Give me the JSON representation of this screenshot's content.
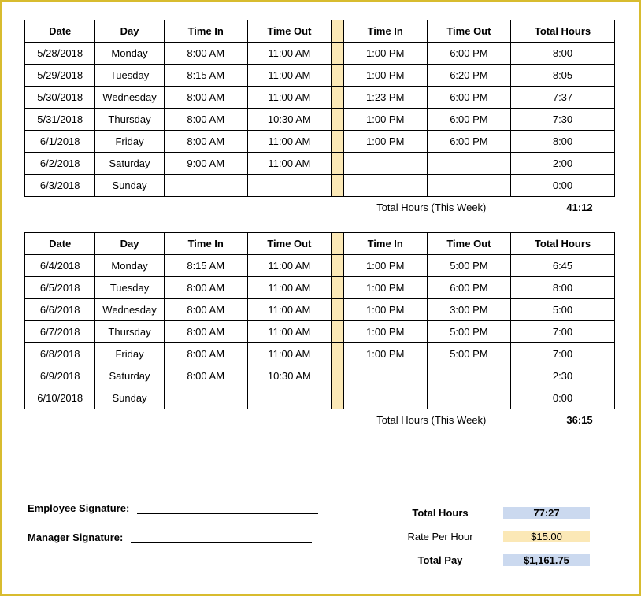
{
  "headers": {
    "date": "Date",
    "day": "Day",
    "time_in": "Time In",
    "time_out": "Time Out",
    "total_hours": "Total Hours"
  },
  "week_total_label": "Total Hours (This Week)",
  "week1": {
    "rows": [
      {
        "date": "5/28/2018",
        "day": "Monday",
        "in1": "8:00 AM",
        "out1": "11:00 AM",
        "in2": "1:00 PM",
        "out2": "6:00 PM",
        "total": "8:00"
      },
      {
        "date": "5/29/2018",
        "day": "Tuesday",
        "in1": "8:15 AM",
        "out1": "11:00 AM",
        "in2": "1:00 PM",
        "out2": "6:20 PM",
        "total": "8:05"
      },
      {
        "date": "5/30/2018",
        "day": "Wednesday",
        "in1": "8:00 AM",
        "out1": "11:00 AM",
        "in2": "1:23 PM",
        "out2": "6:00 PM",
        "total": "7:37"
      },
      {
        "date": "5/31/2018",
        "day": "Thursday",
        "in1": "8:00 AM",
        "out1": "10:30 AM",
        "in2": "1:00 PM",
        "out2": "6:00 PM",
        "total": "7:30"
      },
      {
        "date": "6/1/2018",
        "day": "Friday",
        "in1": "8:00 AM",
        "out1": "11:00 AM",
        "in2": "1:00 PM",
        "out2": "6:00 PM",
        "total": "8:00"
      },
      {
        "date": "6/2/2018",
        "day": "Saturday",
        "in1": "9:00 AM",
        "out1": "11:00 AM",
        "in2": "",
        "out2": "",
        "total": "2:00"
      },
      {
        "date": "6/3/2018",
        "day": "Sunday",
        "in1": "",
        "out1": "",
        "in2": "",
        "out2": "",
        "total": "0:00"
      }
    ],
    "total": "41:12"
  },
  "week2": {
    "rows": [
      {
        "date": "6/4/2018",
        "day": "Monday",
        "in1": "8:15 AM",
        "out1": "11:00 AM",
        "in2": "1:00 PM",
        "out2": "5:00 PM",
        "total": "6:45"
      },
      {
        "date": "6/5/2018",
        "day": "Tuesday",
        "in1": "8:00 AM",
        "out1": "11:00 AM",
        "in2": "1:00 PM",
        "out2": "6:00 PM",
        "total": "8:00"
      },
      {
        "date": "6/6/2018",
        "day": "Wednesday",
        "in1": "8:00 AM",
        "out1": "11:00 AM",
        "in2": "1:00 PM",
        "out2": "3:00 PM",
        "total": "5:00"
      },
      {
        "date": "6/7/2018",
        "day": "Thursday",
        "in1": "8:00 AM",
        "out1": "11:00 AM",
        "in2": "1:00 PM",
        "out2": "5:00 PM",
        "total": "7:00"
      },
      {
        "date": "6/8/2018",
        "day": "Friday",
        "in1": "8:00 AM",
        "out1": "11:00 AM",
        "in2": "1:00 PM",
        "out2": "5:00 PM",
        "total": "7:00"
      },
      {
        "date": "6/9/2018",
        "day": "Saturday",
        "in1": "8:00 AM",
        "out1": "10:30 AM",
        "in2": "",
        "out2": "",
        "total": "2:30"
      },
      {
        "date": "6/10/2018",
        "day": "Sunday",
        "in1": "",
        "out1": "",
        "in2": "",
        "out2": "",
        "total": "0:00"
      }
    ],
    "total": "36:15"
  },
  "summary": {
    "total_hours_label": "Total Hours",
    "total_hours_value": "77:27",
    "rate_label": "Rate Per Hour",
    "rate_value": "$15.00",
    "pay_label": "Total Pay",
    "pay_value": "$1,161.75"
  },
  "signatures": {
    "employee": "Employee Signature:",
    "manager": "Manager Signature:"
  }
}
